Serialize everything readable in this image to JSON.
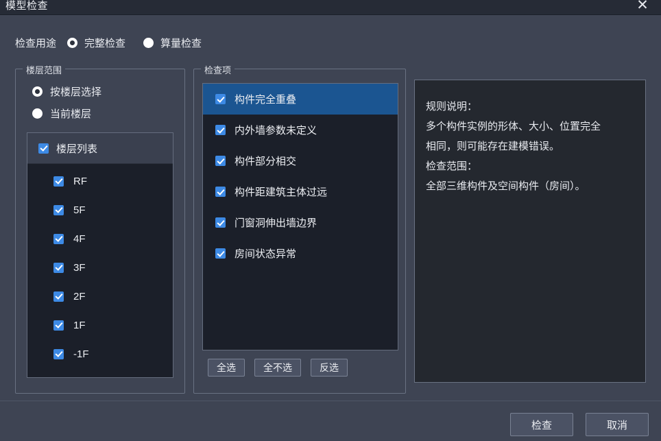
{
  "window": {
    "title": "模型检查",
    "close_icon": "close-icon"
  },
  "purpose": {
    "label": "检查用途",
    "options": [
      {
        "label": "完整检查",
        "selected": true,
        "style": "ring"
      },
      {
        "label": "算量检查",
        "selected": false,
        "style": "solid"
      }
    ]
  },
  "floor_range": {
    "group_title": "楼层范围",
    "radios": [
      {
        "label": "按楼层选择",
        "style": "ring"
      },
      {
        "label": "当前楼层",
        "style": "solid"
      }
    ],
    "list_header": {
      "label": "楼层列表",
      "checked": true
    },
    "floors": [
      {
        "label": "RF",
        "checked": true
      },
      {
        "label": "5F",
        "checked": true
      },
      {
        "label": "4F",
        "checked": true
      },
      {
        "label": "3F",
        "checked": true
      },
      {
        "label": "2F",
        "checked": true
      },
      {
        "label": "1F",
        "checked": true
      },
      {
        "label": "-1F",
        "checked": true
      }
    ]
  },
  "check_items": {
    "group_title": "检查项",
    "items": [
      {
        "label": "构件完全重叠",
        "checked": true,
        "selected": true
      },
      {
        "label": "内外墙参数未定义",
        "checked": true,
        "selected": false
      },
      {
        "label": "构件部分相交",
        "checked": true,
        "selected": false
      },
      {
        "label": "构件距建筑主体过远",
        "checked": true,
        "selected": false
      },
      {
        "label": "门窗洞伸出墙边界",
        "checked": true,
        "selected": false
      },
      {
        "label": "房间状态异常",
        "checked": true,
        "selected": false
      }
    ],
    "select_buttons": [
      {
        "label": "全选"
      },
      {
        "label": "全不选"
      },
      {
        "label": "反选"
      }
    ]
  },
  "rule_description": {
    "lines": [
      "规则说明：",
      "多个构件实例的形体、大小、位置完全",
      "相同，则可能存在建模错误。",
      "检查范围：",
      "全部三维构件及空间构件（房间）。"
    ]
  },
  "actions": {
    "confirm_label": "检查",
    "cancel_label": "取消"
  },
  "colors": {
    "dialog_bg": "#3e4453",
    "titlebar_bg": "#262b36",
    "list_bg": "#1b1f29",
    "selection_blue": "#1b5591",
    "checkbox_blue": "#3d8ae5",
    "border": "#6a7283",
    "text": "#eceef2"
  }
}
